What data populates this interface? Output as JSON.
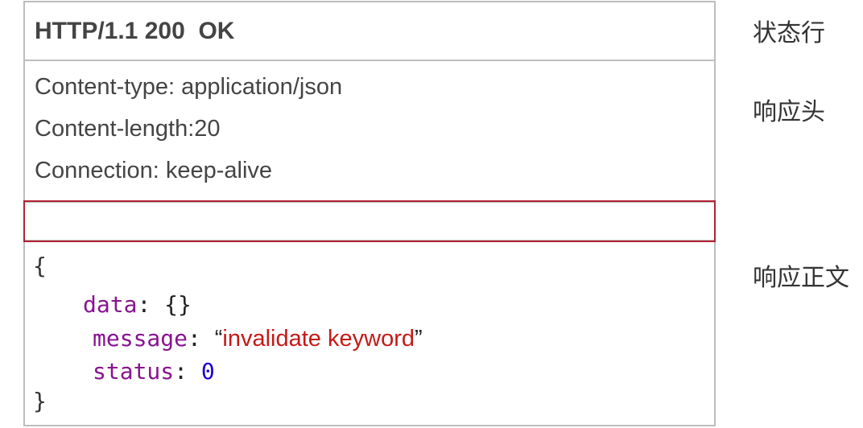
{
  "status_line": {
    "protocol": "HTTP/1.1",
    "code": "200",
    "reason": "OK"
  },
  "headers": [
    "Content-type: application/json",
    "Content-length:20",
    "Connection: keep-alive"
  ],
  "body": {
    "open_brace": "{",
    "close_brace": "}",
    "data_key": "data",
    "data_value": "{}",
    "message_key": "message",
    "message_open_quote": "“",
    "message_value": "invalidate keyword",
    "message_close_quote": "”",
    "status_key": "status",
    "status_value": "0",
    "colon": ":"
  },
  "labels": {
    "status": "状态行",
    "headers": "响应头",
    "body": "响应正文"
  },
  "colors": {
    "border": "#bdbdbd",
    "blank_line_border": "#b22233",
    "key": "#881391",
    "string_value": "#c41a16",
    "number_value": "#1c00cf"
  }
}
